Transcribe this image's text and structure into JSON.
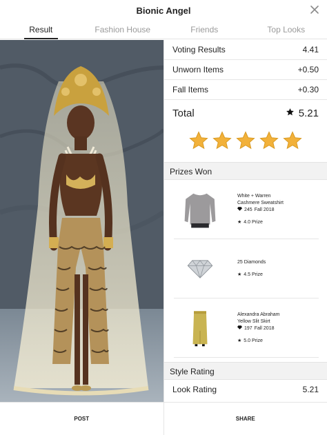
{
  "header": {
    "title": "Bionic Angel",
    "close_icon": "close-icon"
  },
  "tabs": [
    {
      "label": "Result",
      "active": true
    },
    {
      "label": "Fashion House",
      "active": false
    },
    {
      "label": "Friends",
      "active": false
    },
    {
      "label": "Top Looks",
      "active": false
    }
  ],
  "scores": {
    "voting_label": "Voting Results",
    "voting_value": "4.41",
    "unworn_label": "Unworn Items",
    "unworn_value": "+0.50",
    "fall_label": "Fall Items",
    "fall_value": "+0.30",
    "total_label": "Total",
    "total_value": "5.21",
    "star_rating": 5
  },
  "prizes": {
    "section_title": "Prizes Won",
    "items": [
      {
        "name_line1": "White + Warren",
        "name_line2": "Cashmere Sweatshirt",
        "price": "245",
        "season": "Fall 2018",
        "prize": "4.0 Prize"
      },
      {
        "name_line1": "25 Diamonds",
        "name_line2": "",
        "price": "",
        "season": "",
        "prize": "4.5 Prize"
      },
      {
        "name_line1": "Alexandra Abraham",
        "name_line2": "Yellow Slit Skirt",
        "price": "197",
        "season": "Fall 2018",
        "prize": "5.0 Prize"
      }
    ]
  },
  "style": {
    "section_title": "Style Rating",
    "look_label": "Look Rating",
    "look_value": "5.21"
  },
  "bottom": {
    "post_label": "POST",
    "share_label": "SHARE"
  },
  "colors": {
    "star_gold": "#f2b13a",
    "section_bg": "#f2f2f2"
  }
}
